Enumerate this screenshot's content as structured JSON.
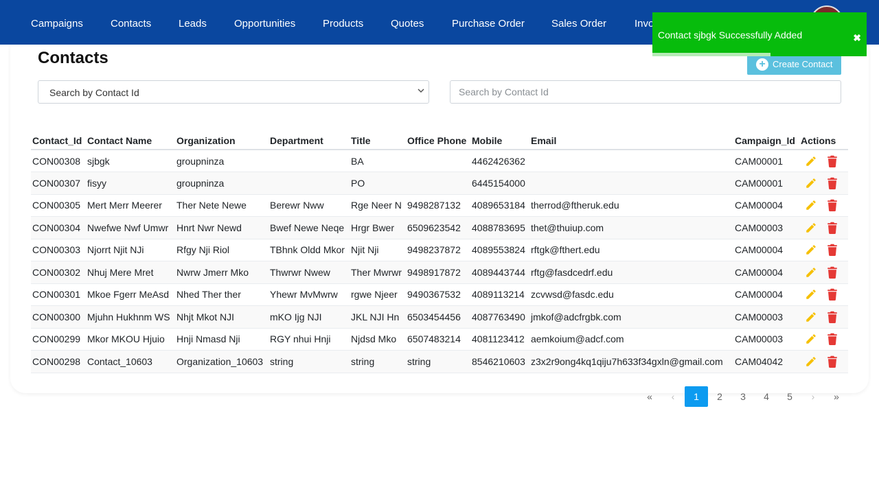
{
  "nav": {
    "items": [
      "Campaigns",
      "Contacts",
      "Leads",
      "Opportunities",
      "Products",
      "Quotes",
      "Purchase Order",
      "Sales Order",
      "Invoice"
    ]
  },
  "page": {
    "title": "Contacts",
    "create_button": "Create Contact",
    "search_select_value": "Search by Contact Id",
    "search_placeholder": "Search by Contact Id"
  },
  "table": {
    "headers": [
      "Contact_Id",
      "Contact Name",
      "Organization",
      "Department",
      "Title",
      "Office Phone",
      "Mobile",
      "Email",
      "Campaign_Id",
      "Actions"
    ],
    "rows": [
      [
        "CON00308",
        "sjbgk",
        "groupninza",
        "",
        "BA",
        "",
        "4462426362",
        "",
        "CAM00001"
      ],
      [
        "CON00307",
        "fisyy",
        "groupninza",
        "",
        "PO",
        "",
        "6445154000",
        "",
        "CAM00001"
      ],
      [
        "CON00305",
        "Mert Merr Meerer",
        "Ther Nete Newe",
        "Berewr Nww",
        "Rge Neer N",
        "9498287132",
        "4089653184",
        "therrod@ftheruk.edu",
        "CAM00004"
      ],
      [
        "CON00304",
        "Nwefwe Nwf Umwr",
        "Hnrt Nwr Newd",
        "Bwef Newe Neqe",
        "Hrgr Bwer",
        "6509623542",
        "4088783695",
        "thet@thuiup.com",
        "CAM00003"
      ],
      [
        "CON00303",
        "Njorrt Njit NJi",
        "Rfgy Nji Riol",
        "TBhnk Oldd Mkor",
        "Njit Nji",
        "9498237872",
        "4089553824",
        "rftgk@fthert.edu",
        "CAM00004"
      ],
      [
        "CON00302",
        "Nhuj Mere Mret",
        "Nwrw Jmerr Mko",
        "Thwrwr Nwew",
        "Ther Mwrwr",
        "9498917872",
        "4089443744",
        "rftg@fasdcedrf.edu",
        "CAM00004"
      ],
      [
        "CON00301",
        "Mkoe Fgerr MeAsd",
        "Nhed Ther ther",
        "Yhewr MvMwrw",
        "rgwe Njeer",
        "9490367532",
        "4089113214",
        "zcvwsd@fasdc.edu",
        "CAM00004"
      ],
      [
        "CON00300",
        "Mjuhn Hukhnm WS",
        "Nhjt Mkot NJI",
        "mKO Ijg NJI",
        "JKL NJI Hn",
        "6503454456",
        "4087763490",
        "jmkof@adcfrgbk.com",
        "CAM00003"
      ],
      [
        "CON00299",
        "Mkor MKOU Hjuio",
        "Hnji Nmasd Nji",
        "RGY nhui Hnji",
        "Njdsd Mko",
        "6507483214",
        "4081123412",
        "aemkoium@adcf.com",
        "CAM00003"
      ],
      [
        "CON00298",
        "Contact_10603",
        "Organization_10603",
        "string",
        "string",
        "string",
        "8546210603",
        "z3x2r9ong4kq1qiju7h633f34gxln@gmail.com",
        "CAM04042"
      ]
    ]
  },
  "pagination": {
    "first": "«",
    "prev": "‹",
    "pages": [
      "1",
      "2",
      "3",
      "4",
      "5"
    ],
    "active_page": "1",
    "next": "›",
    "last": "»"
  },
  "toast": {
    "message": "Contact sjbgk Successfully Added",
    "close": "✖",
    "progress": 0.55
  },
  "icons": {
    "edit": "pencil-icon",
    "delete": "trash-icon",
    "create": "plus-circle-icon"
  },
  "colors": {
    "nav_bg": "#0a479f",
    "create_button": "#5bc0de",
    "edit_icon": "#f6c000",
    "delete_icon": "#e53935",
    "toast_bg": "#07bc0c",
    "active_page": "#0d9bf0"
  }
}
